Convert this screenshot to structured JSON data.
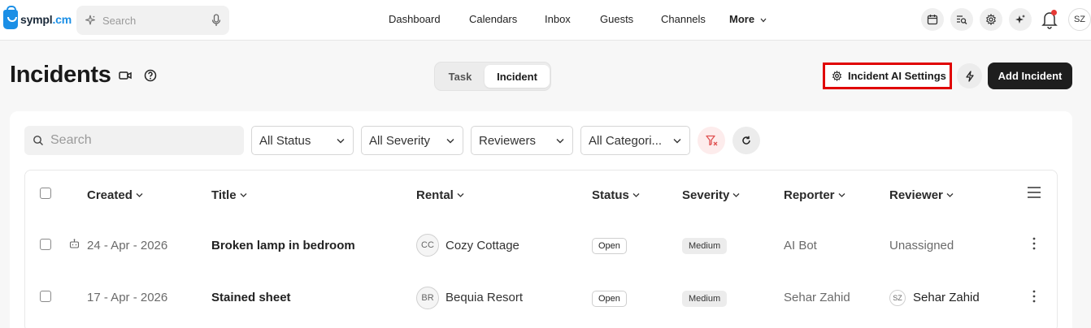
{
  "app": {
    "logo_text_main": "sympl",
    "logo_text_accent": ".cm",
    "search_placeholder": "Search"
  },
  "nav": {
    "items": [
      "Dashboard",
      "Calendars",
      "Inbox",
      "Guests",
      "Channels"
    ],
    "more_label": "More"
  },
  "user": {
    "initials": "SZ",
    "has_notification": true
  },
  "page": {
    "title": "Incidents",
    "tabs": [
      {
        "label": "Task",
        "active": false
      },
      {
        "label": "Incident",
        "active": true
      }
    ],
    "ai_settings_label": "Incident AI Settings",
    "add_label": "Add Incident"
  },
  "filters": {
    "search_placeholder": "Search",
    "status": "All Status",
    "severity": "All Severity",
    "reviewers": "Reviewers",
    "categories": "All Categori..."
  },
  "table": {
    "columns": [
      "Created",
      "Title",
      "Rental",
      "Status",
      "Severity",
      "Reporter",
      "Reviewer"
    ],
    "rows": [
      {
        "created": "24 - Apr - 2026",
        "title": "Broken lamp in bedroom",
        "rental_initials": "CC",
        "rental": "Cozy Cottage",
        "status": "Open",
        "severity": "Medium",
        "reporter": "AI Bot",
        "reviewer": "Unassigned",
        "reviewer_initials": ""
      },
      {
        "created": "17 - Apr - 2026",
        "title": "Stained sheet",
        "rental_initials": "BR",
        "rental": "Bequia Resort",
        "status": "Open",
        "severity": "Medium",
        "reporter": "Sehar Zahid",
        "reviewer": "Sehar Zahid",
        "reviewer_initials": "SZ"
      }
    ]
  },
  "colors": {
    "brand": "#1b8fe6",
    "primary_button": "#1e1e1e",
    "highlight_border": "#e00000",
    "notification": "#e53935"
  }
}
